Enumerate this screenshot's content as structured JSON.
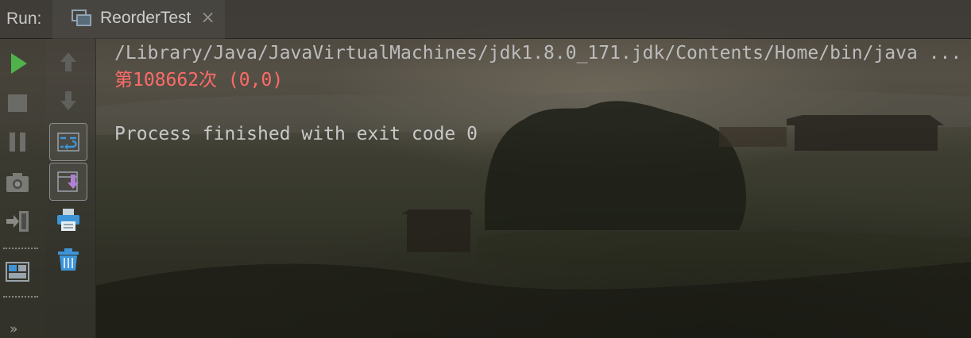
{
  "topbar": {
    "run_label": "Run:",
    "tab": {
      "title": "ReorderTest",
      "close_glyph": "×",
      "icon": "console-window-icon"
    }
  },
  "toolbar": {
    "left": [
      {
        "icon": "run-icon",
        "color": "#4fb34b"
      },
      {
        "icon": "stop-icon"
      },
      {
        "icon": "pause-icon"
      },
      {
        "icon": "camera-dump-threads-icon"
      },
      {
        "icon": "exit-icon"
      },
      {
        "icon": "layout-icon"
      }
    ],
    "right": [
      {
        "icon": "arrow-up-icon"
      },
      {
        "icon": "arrow-down-icon"
      },
      {
        "icon": "soft-wrap-icon"
      },
      {
        "icon": "scroll-to-end-icon"
      },
      {
        "icon": "print-icon"
      },
      {
        "icon": "trash-icon"
      }
    ],
    "more_glyph": "»"
  },
  "console": {
    "lines": [
      {
        "text": "/Library/Java/JavaVirtualMachines/jdk1.8.0_171.jdk/Contents/Home/bin/java ...",
        "kind": "cmd"
      },
      {
        "text": "第108662次 (0,0)",
        "kind": "err"
      },
      {
        "text": "",
        "kind": "blank"
      },
      {
        "text": "Process finished with exit code 0",
        "kind": "normal"
      }
    ]
  },
  "colors": {
    "run_green": "#4fb34b",
    "error_red": "#ff6b68",
    "accent_blue": "#3d95d8",
    "scroll_purple": "#b27fd6"
  }
}
